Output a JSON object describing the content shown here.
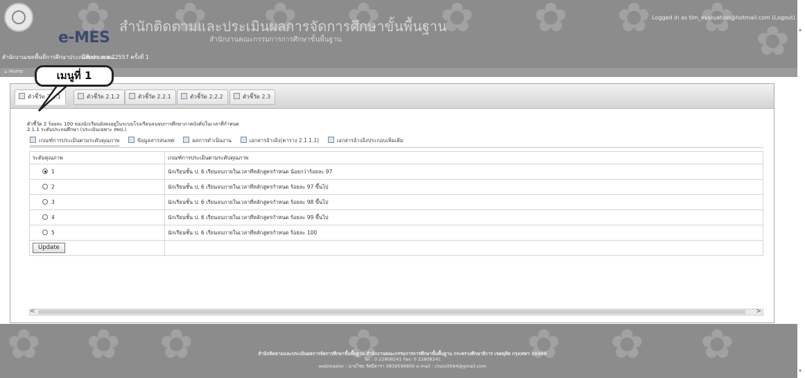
{
  "header": {
    "app_name": "e-MES",
    "org_title": "สำนักติดตามและประเมินผลการจัดการศึกษาขั้นพื้นฐาน",
    "org_subtitle": "สำนักงานคณะกรรมการการศึกษาขั้นพื้นฐาน",
    "area": "สำนักงานเขตพื้นที่การศึกษาประถมศึกษา เขต 1",
    "fiscal": "ปีงบประมาณ 2557 ครั้งที่ 1",
    "login": "Logged in as tim_evaluation@hotmail.com (Logout)"
  },
  "breadcrumb": {
    "home": "Home"
  },
  "callout": {
    "label": "เมนูที่ 1"
  },
  "tabs": [
    {
      "label": "ตัวชี้วัด 2.1.1"
    },
    {
      "label": "ตัวชี้วัด 2.1.2"
    },
    {
      "label": "ตัวชี้วัด 2.2.1"
    },
    {
      "label": "ตัวชี้วัด 2.2.2"
    },
    {
      "label": "ตัวชี้วัด 2.3"
    }
  ],
  "indicator": {
    "line1": "ตัวชี้วัด 2 ร้อยละ 100 ของนักเรียนยังคงอยู่ในระบบโรงเรียนจนจบการศึกษาภาคบังคับในเวลาที่กำหนด",
    "line2": "2.1.1 ระดับประถมศึกษา (ประเมินเฉพาะ สพป.)"
  },
  "subtabs": [
    {
      "label": "เกณฑ์การประเมินตามระดับคุณภาพ"
    },
    {
      "label": "ข้อมูลสารสนเทศ"
    },
    {
      "label": "ผลการดำเนินงาน"
    },
    {
      "label": "เอกสารอ้างอิง(ตาราง 2.1.1.1)"
    },
    {
      "label": "เอกสารอ้างอิงประกอบเพิ่มเติม"
    }
  ],
  "table": {
    "headers": [
      "ระดับคุณภาพ",
      "เกณฑ์การประเมินตามระดับคุณภาพ"
    ],
    "rows": [
      {
        "level": "1",
        "criterion": "นักเรียนชั้น ป. 6 เรียนจบภายในเวลาที่หลักสูตรกำหนด น้อยกว่าร้อยละ 97",
        "selected": true
      },
      {
        "level": "2",
        "criterion": "นักเรียนชั้น ป. 6 เรียนจบภายในเวลาที่หลักสูตรกำหนด ร้อยละ 97 ขึ้นไป",
        "selected": false
      },
      {
        "level": "3",
        "criterion": "นักเรียนชั้น ป. 6 เรียนจบภายในเวลาที่หลักสูตรกำหนด ร้อยละ 98 ขึ้นไป",
        "selected": false
      },
      {
        "level": "4",
        "criterion": "นักเรียนชั้น ป. 6 เรียนจบภายในเวลาที่หลักสูตรกำหนด ร้อยละ 99 ขึ้นไป",
        "selected": false
      },
      {
        "level": "5",
        "criterion": "นักเรียนชั้น ป. 6 เรียนจบภายในเวลาที่หลักสูตรกำหนด ร้อยละ 100",
        "selected": false
      }
    ],
    "update_label": "Update"
  },
  "footer": {
    "line1": "สำนักติดตามและประเมินผลการจัดการศึกษาขั้นพื้นฐาน สำนักงานคณะกรรมการการศึกษาขั้นพื้นฐาน กระทรวงศึกษาธิการ เขตดุสิต กรุงเทพฯ 10300",
    "line2": "Tel : 0 22808241 Fax: 0 22808241",
    "line3": "webmaster : นายไชย รัศมีดารา 0839596800 e-mail : chaivith64@gmail.com"
  },
  "colors": {
    "header_bg": "#8c8c8c",
    "brand_text": "#3b4a6e",
    "panel_border": "#aaaaaa"
  }
}
